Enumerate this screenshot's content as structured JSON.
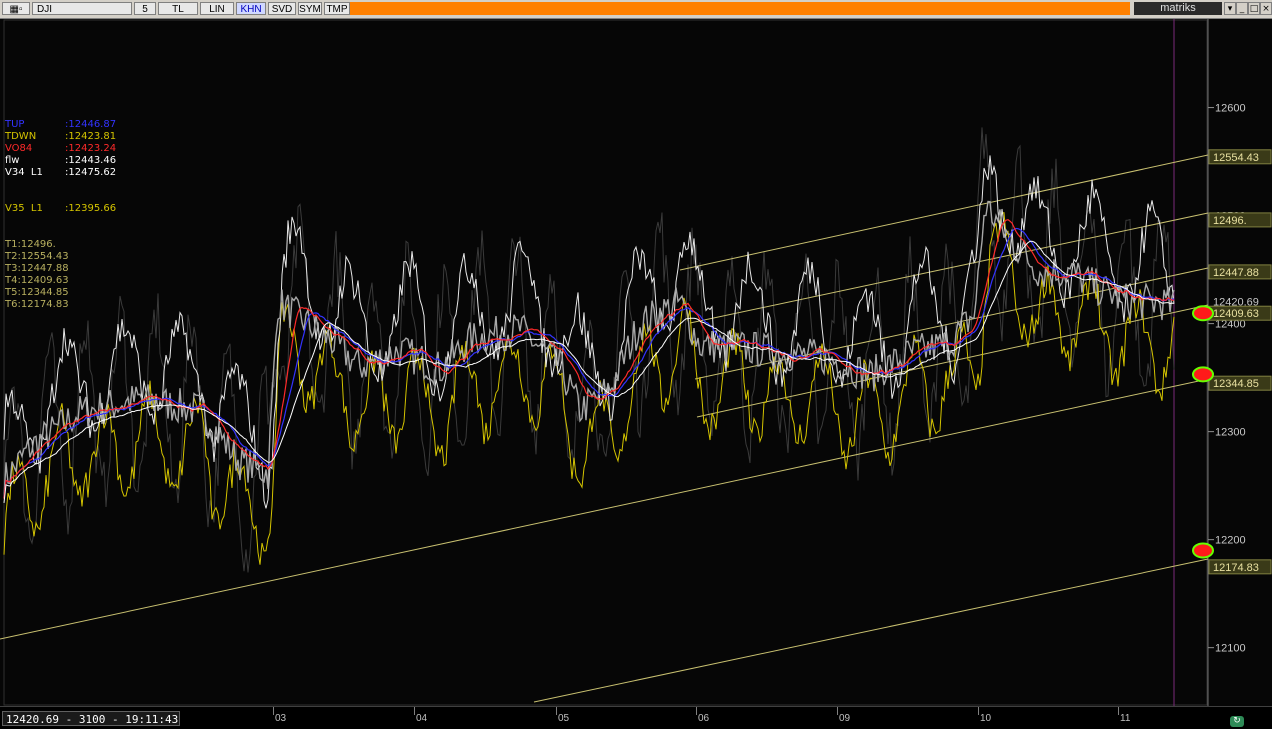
{
  "toolbar": {
    "symbol": "DJI",
    "period": "5",
    "buttons": [
      "TL",
      "LIN",
      "KHN",
      "SVD",
      "SYM",
      "TMP"
    ],
    "active_button": "KHN",
    "brand": "matriks"
  },
  "window_controls": [
    "▾",
    "_",
    "□",
    "×"
  ],
  "status_text": "12420.69 - 3100 - 19:11:43",
  "legend": [
    {
      "label": "TUP",
      "value": ":12446.87",
      "color": "#3333ff"
    },
    {
      "label": "TDWN",
      "value": ":12423.81",
      "color": "#d4c400"
    },
    {
      "label": "VO84",
      "value": ":12423.24",
      "color": "#ff2a2a"
    },
    {
      "label": "flw",
      "value": ":12443.46",
      "color": "#ffffff"
    },
    {
      "label": "V34  L1",
      "value": ":12475.62",
      "color": "#ffffff"
    },
    {
      "label": "",
      "value": "",
      "color": "#000000"
    },
    {
      "label": "",
      "value": "",
      "color": "#000000"
    },
    {
      "label": "V35  L1",
      "value": ":12395.66",
      "color": "#d4c400"
    },
    {
      "label": "",
      "value": "",
      "color": "#000000"
    },
    {
      "label": "",
      "value": "",
      "color": "#000000"
    },
    {
      "label": "T1:12496.",
      "value": "",
      "color": "#b8b060"
    },
    {
      "label": "T2:12554.43",
      "value": "",
      "color": "#b8b060"
    },
    {
      "label": "T3:12447.88",
      "value": "",
      "color": "#b8b060"
    },
    {
      "label": "T4:12409.63",
      "value": "",
      "color": "#b8b060"
    },
    {
      "label": "T5:12344.85",
      "value": "",
      "color": "#b8b060"
    },
    {
      "label": "T6:12174.83",
      "value": "",
      "color": "#b8b060"
    }
  ],
  "chart_data": {
    "type": "line",
    "ylim": [
      12046,
      12682
    ],
    "y_ticks": [
      12100,
      12200,
      12300,
      12400,
      12500,
      12600
    ],
    "x_labels": [
      "03",
      "04",
      "05",
      "06",
      "09",
      "10",
      "11"
    ],
    "current_price": "12420.69",
    "price_labels": [
      {
        "text": "12554.43",
        "value": 12554.43
      },
      {
        "text": "12496.",
        "value": 12496.0
      },
      {
        "text": "12447.88",
        "value": 12447.88
      },
      {
        "text": "12409.63",
        "value": 12409.63
      },
      {
        "text": "12344.85",
        "value": 12344.85
      },
      {
        "text": "12174.83",
        "value": 12174.83
      }
    ],
    "markers": [
      12409.63,
      12353,
      12190
    ],
    "colors": {
      "price": "#a8a8a8",
      "tup": "#3333ff",
      "tdwn": "#d4c400",
      "vo84": "#ff2a2a",
      "flw": "#ffffff",
      "channel": "#c8c070",
      "marker_fill": "#ff1a1a",
      "marker_ring": "#66ff00"
    }
  }
}
